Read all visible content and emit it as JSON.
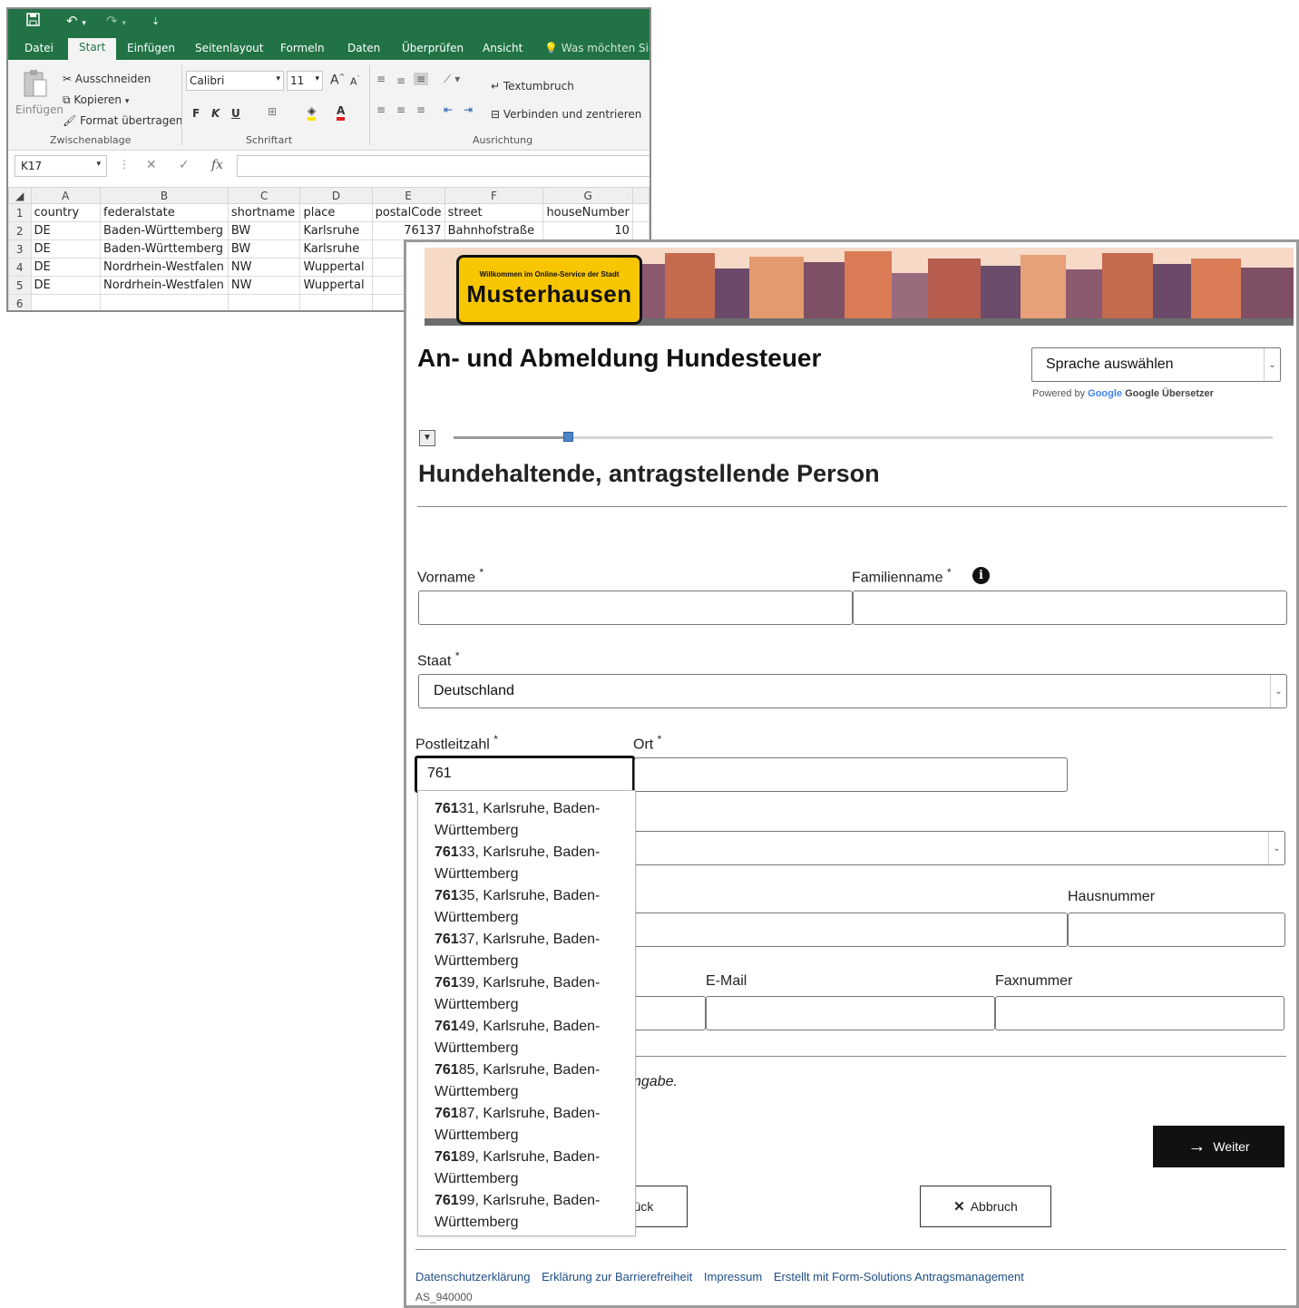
{
  "excel": {
    "qat_icons": [
      "save-icon",
      "undo-icon",
      "redo-icon",
      "customize-icon"
    ],
    "tabs": [
      "Datei",
      "Start",
      "Einfügen",
      "Seitenlayout",
      "Formeln",
      "Daten",
      "Überprüfen",
      "Ansicht"
    ],
    "tellme": "Was möchten Sie t",
    "clipboard": {
      "paste": "Einfügen",
      "cut": "Ausschneiden",
      "copy": "Kopieren",
      "format_painter": "Format übertragen",
      "group": "Zwischenablage"
    },
    "font": {
      "name": "Calibri",
      "size": "11",
      "bold": "F",
      "italic": "K",
      "underline": "U",
      "group": "Schriftart"
    },
    "alignment": {
      "wrap": "Textumbruch",
      "merge": "Verbinden und zentrieren",
      "group": "Ausrichtung"
    },
    "name_box": "K17",
    "fx": "fx",
    "columns": [
      "A",
      "B",
      "C",
      "D",
      "E",
      "F",
      "G"
    ],
    "rows": [
      [
        "1",
        "country",
        "federalstate",
        "shortname",
        "place",
        "postalCode",
        "street",
        "houseNumber"
      ],
      [
        "2",
        "DE",
        "Baden-Württemberg",
        "BW",
        "Karlsruhe",
        "76137",
        "Bahnhofstraße",
        "10"
      ],
      [
        "3",
        "DE",
        "Baden-Württemberg",
        "BW",
        "Karlsruhe",
        "",
        "",
        ""
      ],
      [
        "4",
        "DE",
        "Nordrhein-Westfalen",
        "NW",
        "Wuppertal",
        "",
        "",
        ""
      ],
      [
        "5",
        "DE",
        "Nordrhein-Westfalen",
        "NW",
        "Wuppertal",
        "",
        "",
        ""
      ],
      [
        "6",
        "",
        "",
        "",
        "",
        "",
        "",
        ""
      ]
    ]
  },
  "form": {
    "banner": {
      "welcome": "Willkommen im Online-Service der Stadt",
      "city": "Musterhausen"
    },
    "title": "An- und Abmeldung Hundesteuer",
    "language_select": "Sprache auswählen",
    "powered_by": "Powered by",
    "google": "Google",
    "translator": "Google Übersetzer",
    "progress": 0.14,
    "section_title": "Hundehaltende, antragstellende Person",
    "fields": {
      "vorname": {
        "label": "Vorname",
        "value": ""
      },
      "familienname": {
        "label": "Familienname",
        "value": ""
      },
      "staat": {
        "label": "Staat",
        "value": "Deutschland"
      },
      "plz": {
        "label": "Postleitzahl",
        "value": "761"
      },
      "ort": {
        "label": "Ort",
        "value": ""
      },
      "hausnummer": {
        "label": "Hausnummer",
        "value": ""
      },
      "email": {
        "label": "E-Mail",
        "value": ""
      },
      "fax": {
        "label": "Faxnummer",
        "value": ""
      }
    },
    "required_mark": "*",
    "note": "ngabe.",
    "buttons": {
      "next": "Weiter",
      "back": "ück",
      "cancel": "Abbruch"
    },
    "footer": [
      "Datenschutzerklärung",
      "Erklärung zur Barrierefreiheit",
      "Impressum",
      "Erstellt mit Form-Solutions Antragsmanagement"
    ],
    "form_id": "AS_940000",
    "suggestions": [
      {
        "match": "761",
        "rest": "31, Karlsruhe, Baden-",
        "line2": "Württemberg"
      },
      {
        "match": "761",
        "rest": "33, Karlsruhe, Baden-",
        "line2": "Württemberg"
      },
      {
        "match": "761",
        "rest": "35, Karlsruhe, Baden-",
        "line2": "Württemberg"
      },
      {
        "match": "761",
        "rest": "37, Karlsruhe, Baden-",
        "line2": "Württemberg"
      },
      {
        "match": "761",
        "rest": "39, Karlsruhe, Baden-",
        "line2": "Württemberg"
      },
      {
        "match": "761",
        "rest": "49, Karlsruhe, Baden-",
        "line2": "Württemberg"
      },
      {
        "match": "761",
        "rest": "85, Karlsruhe, Baden-",
        "line2": "Württemberg"
      },
      {
        "match": "761",
        "rest": "87, Karlsruhe, Baden-",
        "line2": "Württemberg"
      },
      {
        "match": "761",
        "rest": "89, Karlsruhe, Baden-",
        "line2": "Württemberg"
      },
      {
        "match": "761",
        "rest": "99, Karlsruhe, Baden-",
        "line2": "Württemberg"
      }
    ]
  }
}
